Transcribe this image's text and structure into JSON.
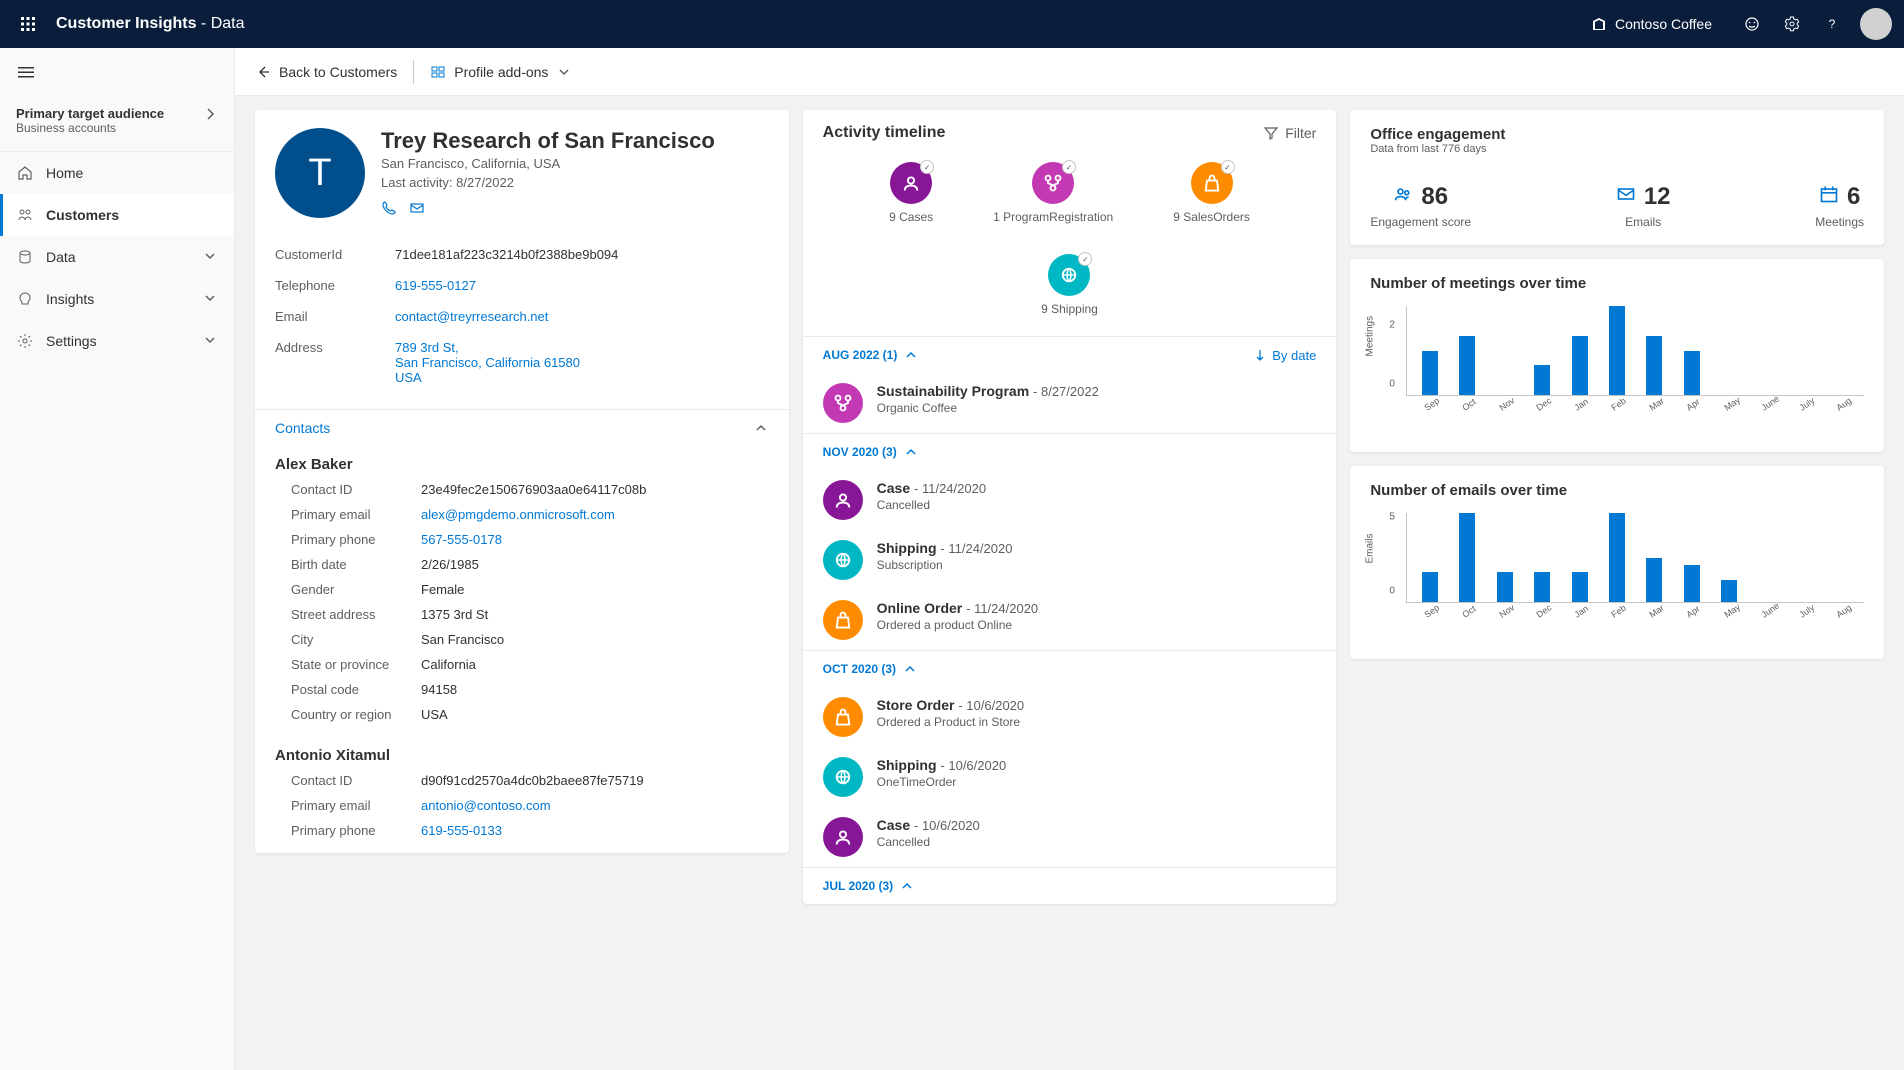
{
  "topbar": {
    "product": "Customer Insights",
    "product_sub": "Data",
    "tenant": "Contoso Coffee"
  },
  "sidebar": {
    "audience_title": "Primary target audience",
    "audience_sub": "Business accounts",
    "items": [
      {
        "label": "Home",
        "icon": "home"
      },
      {
        "label": "Customers",
        "icon": "customers",
        "active": true
      },
      {
        "label": "Data",
        "icon": "data",
        "expandable": true
      },
      {
        "label": "Insights",
        "icon": "insights",
        "expandable": true
      },
      {
        "label": "Settings",
        "icon": "settings",
        "expandable": true
      }
    ]
  },
  "cmdbar": {
    "back": "Back to Customers",
    "addons": "Profile add-ons"
  },
  "profile": {
    "initial": "T",
    "name": "Trey Research of San Francisco",
    "location": "San Francisco, California, USA",
    "last_activity": "Last activity: 8/27/2022",
    "fields": [
      {
        "label": "CustomerId",
        "value": "71dee181af223c3214b0f2388be9b094"
      },
      {
        "label": "Telephone",
        "value": "619-555-0127",
        "link": true
      },
      {
        "label": "Email",
        "value": "contact@treyrresearch.net",
        "link": true
      },
      {
        "label": "Address",
        "value": "789 3rd St,\nSan Francisco, California 61580\nUSA",
        "link": true
      }
    ],
    "contacts_label": "Contacts",
    "contacts": [
      {
        "name": "Alex Baker",
        "rows": [
          {
            "label": "Contact ID",
            "value": "23e49fec2e150676903aa0e64117c08b"
          },
          {
            "label": "Primary email",
            "value": "alex@pmgdemo.onmicrosoft.com",
            "link": true
          },
          {
            "label": "Primary phone",
            "value": "567-555-0178",
            "link": true
          },
          {
            "label": "Birth date",
            "value": "2/26/1985"
          },
          {
            "label": "Gender",
            "value": "Female"
          },
          {
            "label": "Street address",
            "value": "1375 3rd St"
          },
          {
            "label": "City",
            "value": "San Francisco"
          },
          {
            "label": "State or province",
            "value": "California"
          },
          {
            "label": "Postal code",
            "value": "94158"
          },
          {
            "label": "Country or region",
            "value": "USA"
          }
        ]
      },
      {
        "name": "Antonio Xitamul",
        "rows": [
          {
            "label": "Contact ID",
            "value": "d90f91cd2570a4dc0b2baee87fe75719"
          },
          {
            "label": "Primary email",
            "value": "antonio@contoso.com",
            "link": true
          },
          {
            "label": "Primary phone",
            "value": "619-555-0133",
            "link": true
          }
        ]
      }
    ]
  },
  "timeline": {
    "title": "Activity timeline",
    "filter": "Filter",
    "summary": [
      {
        "label": "9 Cases",
        "color": "purple",
        "icon": "person"
      },
      {
        "label": "1 ProgramRegistration",
        "color": "magenta",
        "icon": "branch"
      },
      {
        "label": "9 SalesOrders",
        "color": "orange",
        "icon": "bag"
      },
      {
        "label": "9 Shipping",
        "color": "teal",
        "icon": "globe"
      }
    ],
    "sort": "By date",
    "groups": [
      {
        "label": "AUG 2022 (1)",
        "show_sort": true,
        "items": [
          {
            "color": "magenta",
            "icon": "branch",
            "title": "Sustainability Program",
            "date": "8/27/2022",
            "sub": "Organic Coffee"
          }
        ]
      },
      {
        "label": "NOV 2020 (3)",
        "items": [
          {
            "color": "purple",
            "icon": "person",
            "title": "Case",
            "date": "11/24/2020",
            "sub": "Cancelled"
          },
          {
            "color": "teal",
            "icon": "globe",
            "title": "Shipping",
            "date": "11/24/2020",
            "sub": "Subscription"
          },
          {
            "color": "orange",
            "icon": "bag",
            "title": "Online Order",
            "date": "11/24/2020",
            "sub": "Ordered a product Online"
          }
        ]
      },
      {
        "label": "OCT 2020 (3)",
        "items": [
          {
            "color": "orange",
            "icon": "bag",
            "title": "Store Order",
            "date": "10/6/2020",
            "sub": "Ordered a Product in Store"
          },
          {
            "color": "teal",
            "icon": "globe",
            "title": "Shipping",
            "date": "10/6/2020",
            "sub": "OneTimeOrder"
          },
          {
            "color": "purple",
            "icon": "person",
            "title": "Case",
            "date": "10/6/2020",
            "sub": "Cancelled"
          }
        ]
      },
      {
        "label": "JUL 2020 (3)",
        "items": []
      }
    ]
  },
  "engagement": {
    "title": "Office engagement",
    "sub": "Data from last 776 days",
    "stats": [
      {
        "icon": "people",
        "value": "86",
        "label": "Engagement score"
      },
      {
        "icon": "mail",
        "value": "12",
        "label": "Emails"
      },
      {
        "icon": "calendar",
        "value": "6",
        "label": "Meetings"
      }
    ]
  },
  "chart_data": [
    {
      "type": "bar",
      "title": "Number of meetings over time",
      "ylabel": "Meetings",
      "categories": [
        "Sep",
        "Oct",
        "Nov",
        "Dec",
        "Jan",
        "Feb",
        "Mar",
        "Apr",
        "May",
        "June",
        "July",
        "Aug"
      ],
      "values": [
        1.5,
        2,
        0,
        1,
        2,
        3,
        2,
        1.5,
        0,
        0,
        0,
        0
      ],
      "ylim": [
        0,
        3
      ],
      "yticks": [
        0,
        2
      ]
    },
    {
      "type": "bar",
      "title": "Number of emails over time",
      "ylabel": "Emails",
      "categories": [
        "Sep",
        "Oct",
        "Nov",
        "Dec",
        "Jan",
        "Feb",
        "Mar",
        "Apr",
        "May",
        "June",
        "July",
        "Aug"
      ],
      "values": [
        2,
        6,
        2,
        2,
        2,
        6,
        3,
        2.5,
        1.5,
        0,
        0,
        0
      ],
      "ylim": [
        0,
        6
      ],
      "yticks": [
        0,
        5
      ]
    }
  ]
}
